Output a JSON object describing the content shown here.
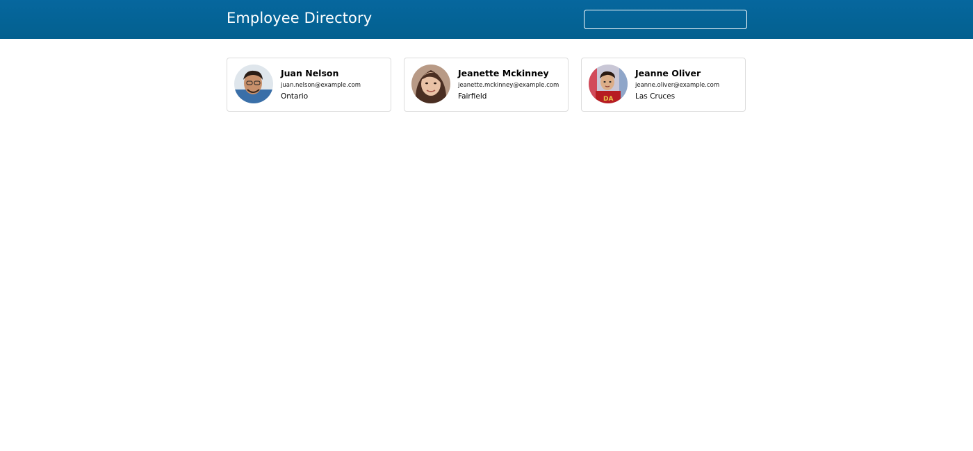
{
  "header": {
    "title": "Employee Directory",
    "search_value": "",
    "background": "#03608f"
  },
  "employees": [
    {
      "name": "Juan Nelson",
      "email": "juan.nelson@example.com",
      "location": "Ontario",
      "avatar": "avatar-photo-icon"
    },
    {
      "name": "Jeanette Mckinney",
      "email": "jeanette.mckinney@example.com",
      "location": "Fairfield",
      "avatar": "avatar-photo-icon"
    },
    {
      "name": "Jeanne Oliver",
      "email": "jeanne.oliver@example.com",
      "location": "Las Cruces",
      "avatar": "avatar-photo-icon"
    }
  ]
}
